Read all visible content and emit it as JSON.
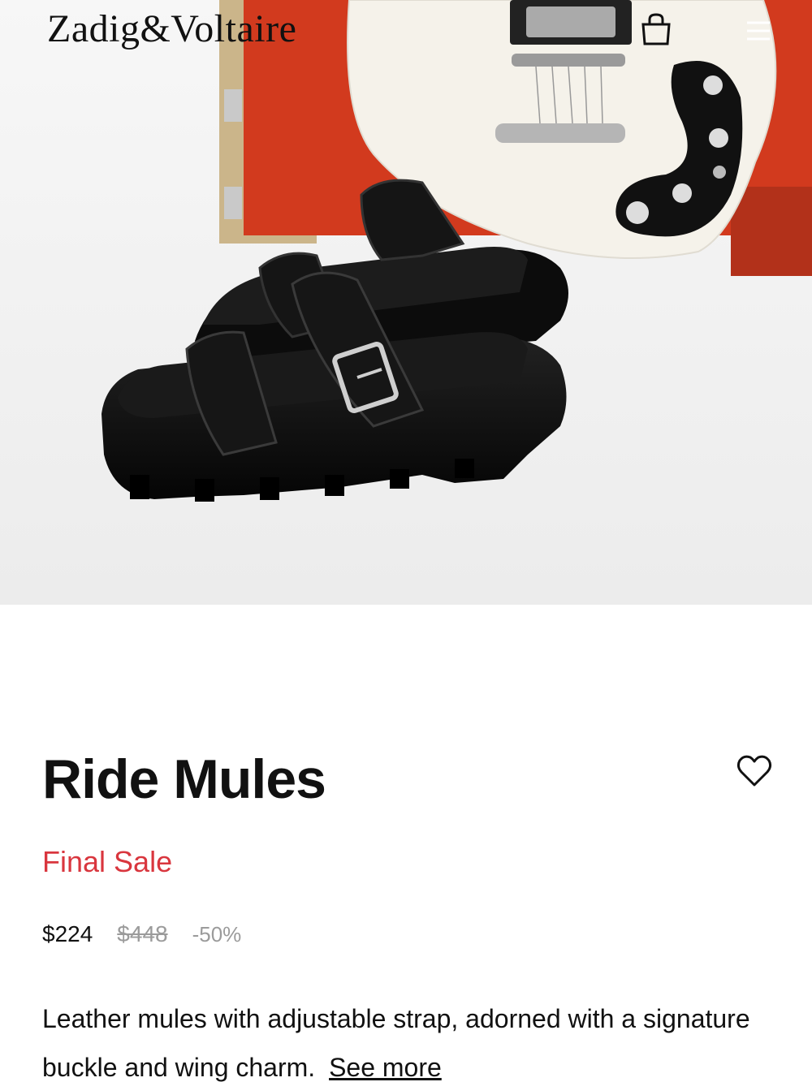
{
  "header": {
    "logo_text": "Zadig&Voltaire",
    "cart_icon": "shopping-bag-icon",
    "menu_icon": "hamburger-menu-icon"
  },
  "hero": {
    "image": "product-photo-ride-mules-with-guitar"
  },
  "product": {
    "title": "Ride Mules",
    "sale_label": "Final Sale",
    "price": "$224",
    "original_price": "$448",
    "discount": "-50%",
    "description": "Leather mules with adjustable strap, adorned with a signature buckle and wing charm.",
    "see_more": "See more",
    "wishlist_icon": "heart-outline-icon"
  },
  "colors": {
    "sale_red": "#d9363e",
    "muted_gray": "#9b9b9b",
    "text": "#111111"
  }
}
